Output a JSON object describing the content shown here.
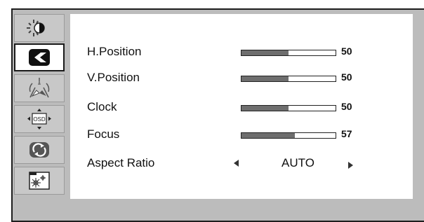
{
  "menu": {
    "icons": [
      "brightness-contrast-icon",
      "image-setup-icon",
      "color-setup-icon",
      "osd-setup-icon",
      "reset-icon",
      "extra-icon"
    ],
    "icons_label": "OSD"
  },
  "settings": [
    {
      "label": "H.Position",
      "value": "50",
      "level": 0.5
    },
    {
      "label": "V.Position",
      "value": "50",
      "level": 0.5
    },
    {
      "label": "Clock",
      "value": "50",
      "level": 0.5
    },
    {
      "label": "Focus",
      "value": "57",
      "level": 0.57
    }
  ],
  "aspect_ratio": {
    "label": "Aspect Ratio",
    "value": "AUTO"
  },
  "colors": {
    "frame": "#bcbcbc",
    "fill": "#6e6e6e",
    "panel": "#ffffff"
  }
}
